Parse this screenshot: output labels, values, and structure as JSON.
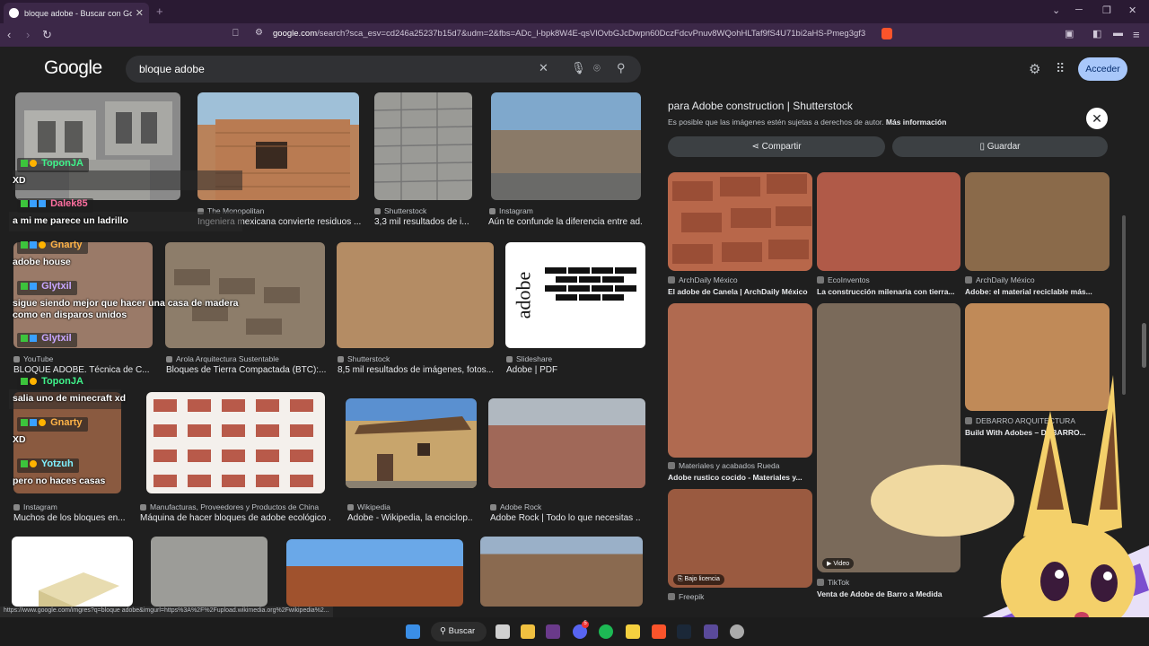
{
  "browser": {
    "tab_title": "bloque adobe - Buscar con Google",
    "new_tab": "+",
    "url_prefix": "google.com",
    "url_rest": "/search?sca_esv=cd246a25237b15d7&udm=2&fbs=ADc_l-bpk8W4E-qsVlOvbGJcDwpn60DczFdcvPnuv8WQohHLTaf9fS4U71bi2aHS-Pmeg3gf3Rx3...",
    "status_url": "https://www.google.com/imgres?q=bloque adobe&imgurl=https%3A%2F%2Fupload.wikimedia.org%2Fwikipedia%2..."
  },
  "google": {
    "logo": "Google",
    "query": "bloque adobe",
    "signin_label": "Acceder"
  },
  "results": [
    {
      "source": "",
      "caption": "",
      "color": "#8a8a8a"
    },
    {
      "source": "The Monopolitan",
      "caption": "Ingeniera mexicana convierte residuos ...",
      "color": "#b9825a"
    },
    {
      "source": "Shutterstock",
      "caption": "3,3 mil resultados de i...",
      "color": "#9a9a96"
    },
    {
      "source": "Instagram",
      "caption": "Aún te confunde la diferencia entre ad...",
      "color": "#8e7660"
    },
    {
      "source": "YouTube",
      "caption": "BLOQUE ADOBE. Técnica de C...",
      "color": "#9a7a68"
    },
    {
      "source": "Arola Arquitectura Sustentable",
      "caption": "Bloques de Tierra Compactada (BTC):...",
      "color": "#8d7d6a"
    },
    {
      "source": "Shutterstock",
      "caption": "8,5 mil resultados de imágenes, fotos...",
      "color": "#b48c64"
    },
    {
      "source": "Slideshare",
      "caption": "Adobe | PDF",
      "color": "#ffffff"
    },
    {
      "source": "Instagram",
      "caption": "Muchos de los bloques en...",
      "color": "#8a5a40"
    },
    {
      "source": "Manufacturas, Proveedores y Productos de China",
      "caption": "Máquina de hacer bloques de adobe ecológico ...",
      "color": "#f4f0ec"
    },
    {
      "source": "Wikipedia",
      "caption": "Adobe - Wikipedia, la enciclop...",
      "color": "#c8a56c"
    },
    {
      "source": "Adobe Rock",
      "caption": "Adobe Rock | Todo lo que necesitas ...",
      "color": "#a06858"
    }
  ],
  "slideshare_text": "adobe",
  "chat": [
    {
      "user": "ToponJA",
      "message": "XD"
    },
    {
      "user": "Dalek85",
      "message": "a mi me parece un ladrillo"
    },
    {
      "user": "Gnarty",
      "message": "adobe house"
    },
    {
      "user": "Glytxil",
      "message": "sigue siendo mejor que hacer una casa de madera"
    },
    {
      "user": "",
      "message": "como en disparos unidos"
    },
    {
      "user": "Glytxil",
      "message": ""
    },
    {
      "user": "ToponJA",
      "message": "salia uno de minecraft xd"
    },
    {
      "user": "Gnarty",
      "message": "XD"
    },
    {
      "user": "Yotzuh",
      "message": "pero no haces casas"
    }
  ],
  "panel": {
    "title": "para Adobe construction | Shutterstock",
    "copyright": "Es posible que las imágenes estén sujetas a derechos de autor.",
    "more_info": "Más información",
    "share_label": "Compartir",
    "save_label": "Guardar",
    "related": [
      {
        "source": "ArchDaily México",
        "caption": "El adobe de Canela | ArchDaily México",
        "color": "#b8674a"
      },
      {
        "source": "EcoInventos",
        "caption": "La construcción milenaria con tierra...",
        "color": "#b05a48"
      },
      {
        "source": "ArchDaily México",
        "caption": "Adobe: el material reciclable más...",
        "color": "#8a6a4a"
      },
      {
        "source": "Materiales y acabados Rueda",
        "caption": "Adobe rustico cocido - Materiales y...",
        "color": "#b06a50"
      },
      {
        "source": "",
        "caption": "",
        "color": "#7a6a5a"
      },
      {
        "source": "DEBARRO ARQUITECTURA",
        "caption": "Build With Adobes – DEBARRO...",
        "color": "#c08a58"
      },
      {
        "source": "Freepik",
        "caption": "",
        "color": "#9a5a40"
      },
      {
        "source": "TikTok",
        "caption": "Venta de Adobe de Barro a Medida",
        "color": "#8a7060"
      }
    ],
    "badge_license": "Bajo licencia",
    "badge_video": "Video"
  },
  "taskbar": {
    "search_label": "Buscar",
    "notif_count": "5"
  }
}
